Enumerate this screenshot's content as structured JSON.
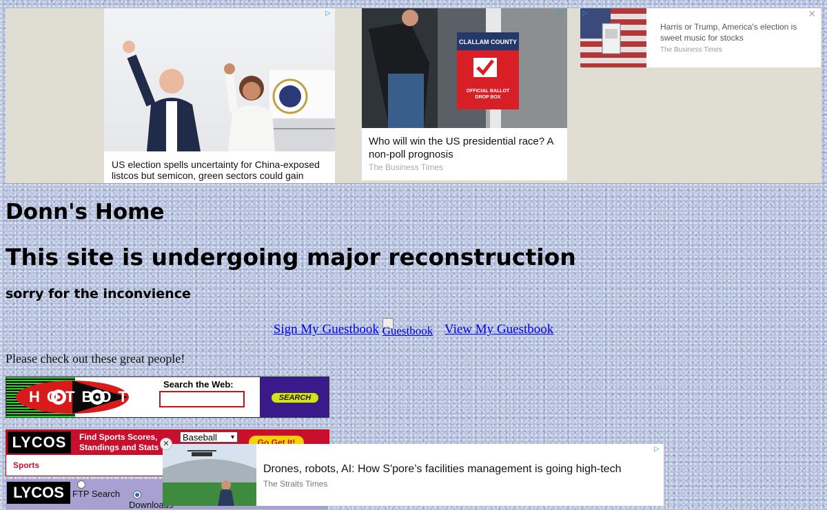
{
  "ads": [
    {
      "headline": "US election spells uncertainty for China-exposed listcos but semicon, green sectors could gain",
      "source": ""
    },
    {
      "headline": "Who will win the US presidential race? A non-poll prognosis",
      "source": "The Business Times",
      "sign": "CLALLAM COUNTY",
      "sign_sub": "OFFICIAL BALLOT DROP BOX"
    },
    {
      "headline": "Harris or Trump, America's election is sweet music for stocks",
      "source": "The Business Times",
      "close": "✕"
    }
  ],
  "adchoice_icon": "▷",
  "page": {
    "title": "Donn's Home",
    "subtitle": "This site is undergoing major reconstruction",
    "apology": "sorry for the inconvience"
  },
  "guestbook": {
    "sign_link": "Sign My Guestbook",
    "image_alt": "Guestbook",
    "view_link": "View My Guestbook"
  },
  "promo_text": "Please check out these great people!",
  "hotbot": {
    "logo": "HOTBOT",
    "label": "Search the Web:",
    "button": "SEARCH"
  },
  "lycos_sports": {
    "logo": "LYCOS",
    "text": "Find Sports Scores, Standings and Stats",
    "selected": "Baseball",
    "button": "Go Get It!",
    "tag": "Sports"
  },
  "lycos_ftp": {
    "logo": "LYCOS",
    "option1": "FTP Search",
    "option2": "Downloads"
  },
  "float_ad": {
    "headline": "Drones, robots, AI: How S'pore’s facilities management is going high-tech",
    "source": "The Straits Times",
    "close": "✕"
  },
  "colors": {
    "background": "#b4c0dc",
    "link": "#0000ee",
    "lycos_red": "#c8102e"
  }
}
